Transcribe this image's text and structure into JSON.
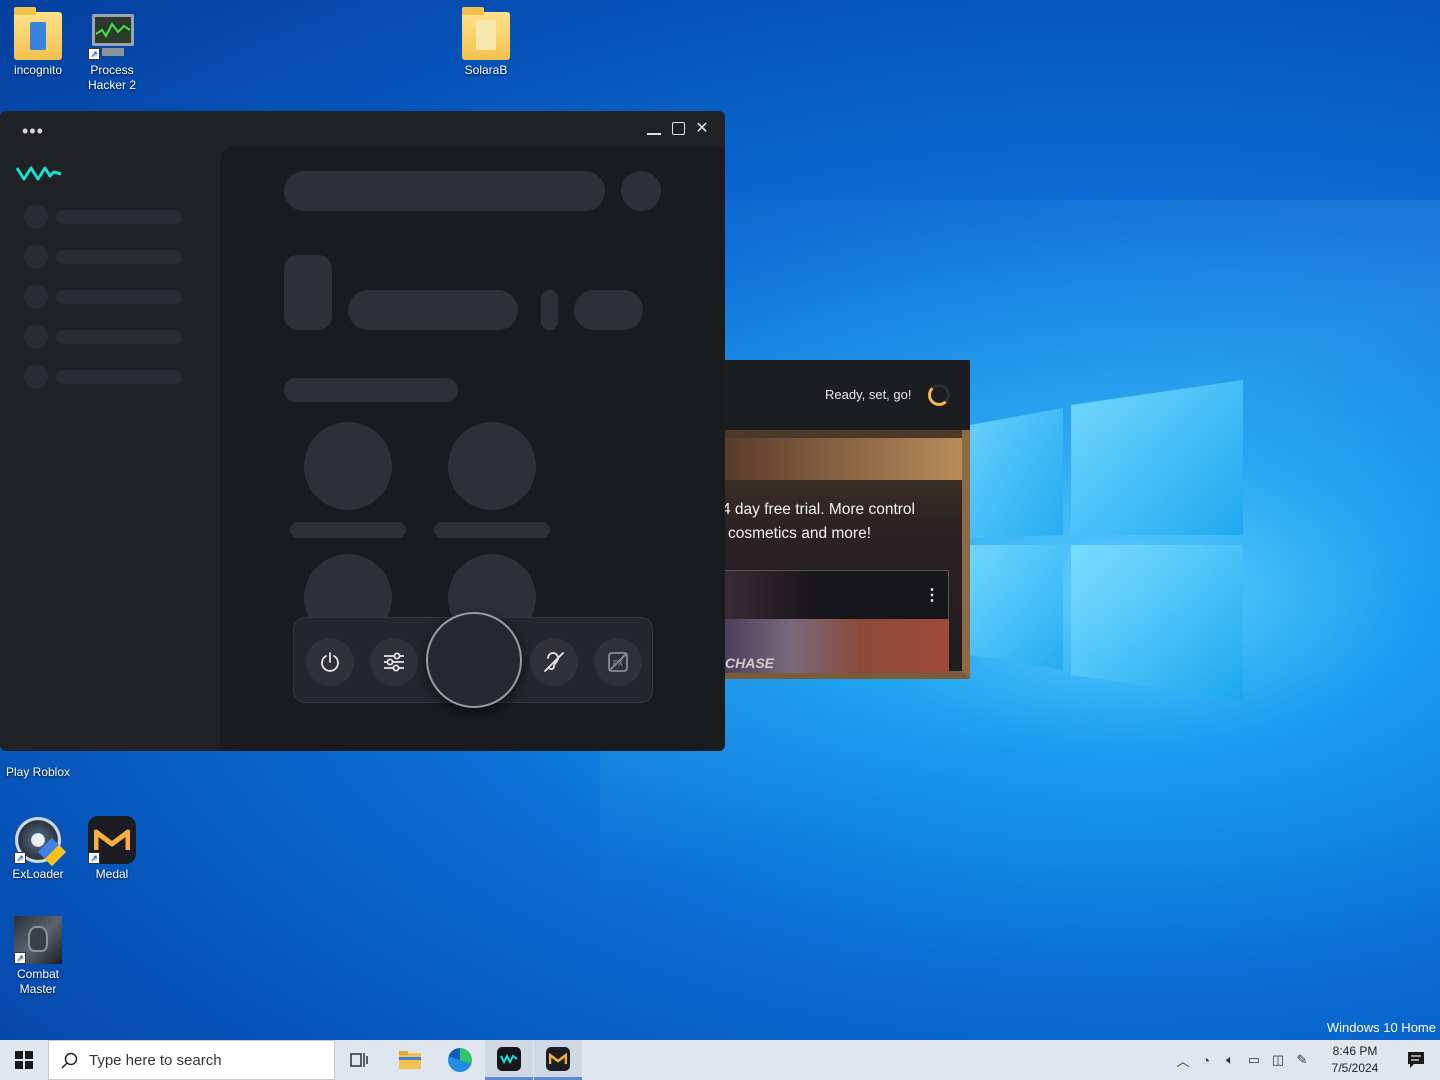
{
  "desktop": {
    "icons": [
      {
        "label": "incognito",
        "icon": "folder-icon"
      },
      {
        "label": "Process Hacker 2",
        "icon": "process-hacker-icon"
      },
      {
        "label": "SolaraB",
        "icon": "folder-icon"
      },
      {
        "label": "Play Roblox",
        "icon": "roblox-icon"
      },
      {
        "label": "ExLoader",
        "icon": "exloader-icon"
      },
      {
        "label": "Medal",
        "icon": "medal-icon"
      },
      {
        "label": "Combat Master",
        "icon": "combat-master-icon"
      }
    ],
    "watermark": "Windows 10 Home"
  },
  "app_window": {
    "logo": "VM",
    "menu_icon": "more-dots-icon",
    "controls": {
      "minimize": "_",
      "maximize": "☐",
      "close": "✕"
    },
    "dock_icons": [
      "power-icon",
      "sliders-icon",
      "hearing-off-icon",
      "effects-off-icon"
    ],
    "accent": "#19e0d3"
  },
  "medal_window": {
    "status": "Ready, set, go!",
    "promo_line1": "4 day free trial. More control",
    "promo_line2": "cosmetics and more!",
    "video_caption": "CHASE",
    "accent": "#f2b84b"
  },
  "taskbar": {
    "search_placeholder": "Type here to search",
    "time": "8:46 PM",
    "date": "7/5/2024",
    "pinned": [
      "task-view-icon",
      "file-explorer-icon",
      "edge-icon",
      "vm-app-icon",
      "medal-icon"
    ]
  }
}
